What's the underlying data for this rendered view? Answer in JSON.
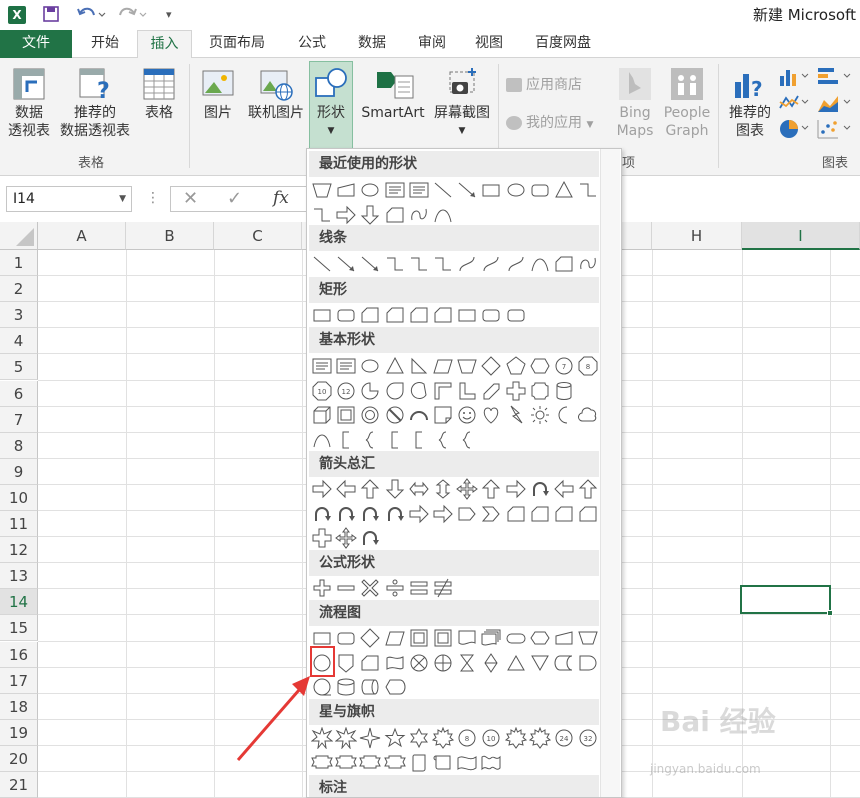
{
  "app": {
    "window_title": "新建 Microsoft",
    "logo_letter": "X"
  },
  "tabs": [
    "文件",
    "开始",
    "插入",
    "页面布局",
    "公式",
    "数据",
    "审阅",
    "视图",
    "百度网盘"
  ],
  "ribbon": {
    "pivot": [
      "数据",
      "透视表"
    ],
    "recommended_pivot": [
      "推荐的",
      "数据透视表"
    ],
    "table": "表格",
    "group_tables": "表格",
    "picture": "图片",
    "online_picture": "联机图片",
    "shapes": "形状",
    "smartart": "SmartArt",
    "screenshot": "屏幕截图",
    "app_store": "应用商店",
    "my_apps": "我的应用",
    "bing_maps": [
      "Bing",
      "Maps"
    ],
    "people_graph": [
      "People",
      "Graph"
    ],
    "apps_group_partial": "项",
    "recommended_chart": [
      "推荐的",
      "图表"
    ],
    "group_charts": "图表"
  },
  "formula_bar": {
    "name_box": "I14",
    "fx": "fx"
  },
  "columns": [
    "A",
    "B",
    "C",
    "H",
    "I"
  ],
  "rows": [
    "1",
    "2",
    "3",
    "4",
    "5",
    "6",
    "7",
    "8",
    "9",
    "10",
    "11",
    "12",
    "13",
    "14",
    "15",
    "16",
    "17",
    "18",
    "19",
    "20",
    "21"
  ],
  "selected_cell": "I14",
  "gallery": {
    "categories": [
      "最近使用的形状",
      "线条",
      "矩形",
      "基本形状",
      "箭头总汇",
      "公式形状",
      "流程图",
      "星与旗帜",
      "标注"
    ],
    "highlighted_shape": "flowchart-connector-circle"
  },
  "watermark": {
    "main": "Bai 经验",
    "sub": "jingyan.baidu.com"
  },
  "colors": {
    "excel_green": "#217346",
    "highlight_red": "#e53935"
  }
}
